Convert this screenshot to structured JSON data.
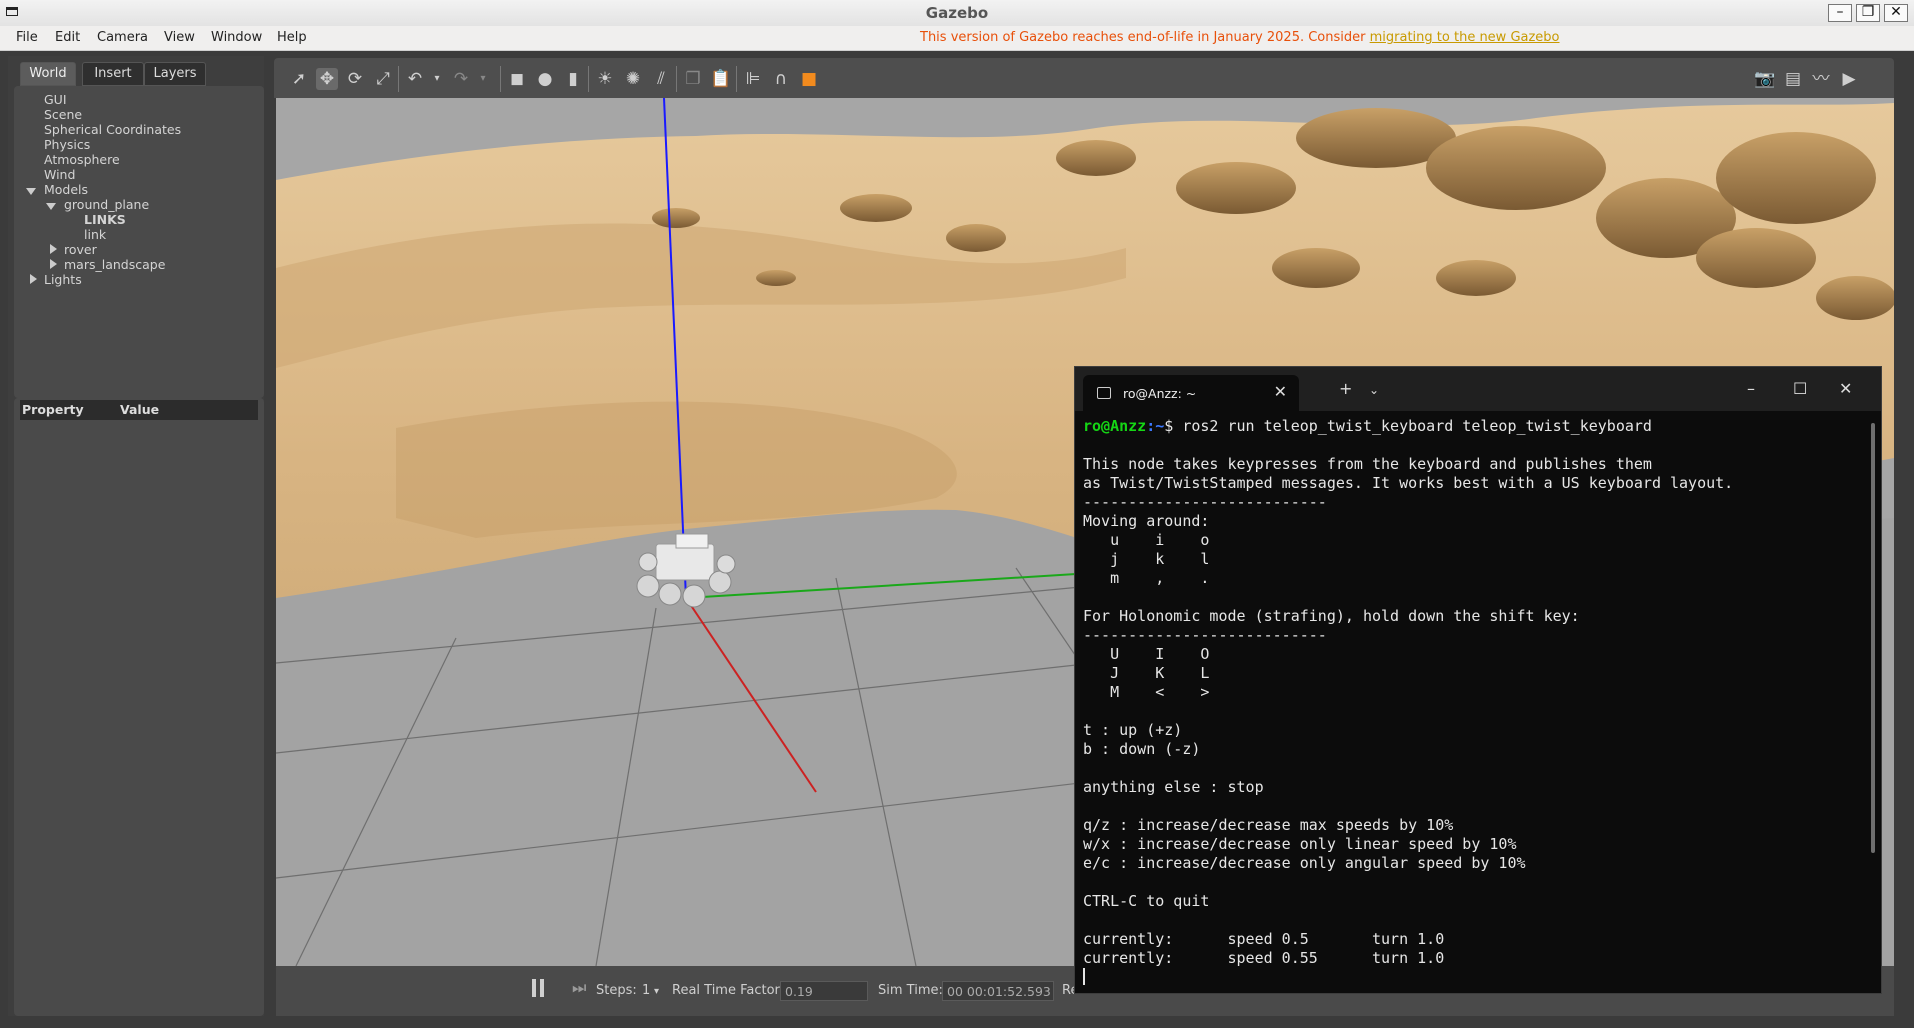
{
  "window": {
    "title": "Gazebo"
  },
  "menu": {
    "items": [
      "File",
      "Edit",
      "Camera",
      "View",
      "Window",
      "Help"
    ],
    "notice_prefix": "This version of Gazebo reaches end-of-life in January 2025. Consider ",
    "notice_link": "migrating to the new Gazebo"
  },
  "left_panel": {
    "tabs": [
      "World",
      "Insert",
      "Layers"
    ],
    "tree": {
      "gui": "GUI",
      "scene": "Scene",
      "spherical": "Spherical Coordinates",
      "physics": "Physics",
      "atmosphere": "Atmosphere",
      "wind": "Wind",
      "models": "Models",
      "ground_plane": "ground_plane",
      "links": "LINKS",
      "link": "link",
      "rover": "rover",
      "mars_landscape": "mars_landscape",
      "lights": "Lights"
    },
    "property_header": "Property",
    "value_header": "Value"
  },
  "toolbar": {
    "tools": [
      "select-icon",
      "translate-icon",
      "rotate-icon",
      "scale-icon",
      "undo-icon",
      "redo-icon",
      "box-icon",
      "sphere-icon",
      "cylinder-icon",
      "point-light-icon",
      "spot-light-icon",
      "directional-light-icon",
      "copy-icon",
      "paste-icon",
      "align-icon",
      "snap-icon",
      "change-view-icon",
      "screenshot-icon",
      "log-icon",
      "plot-icon",
      "video-icon"
    ]
  },
  "status_bar": {
    "steps_label": "Steps:",
    "steps_value": "1",
    "rtf_label": "Real Time Factor:",
    "rtf_value": "0.19",
    "sim_time_label": "Sim Time:",
    "sim_time_value": "00 00:01:52.593",
    "real_time_label": "Real Time:"
  },
  "terminal": {
    "tab_title": "ro@Anzz: ~",
    "prompt_user": "ro@Anzz",
    "prompt_path": ":~",
    "command": "$ ros2 run teleop_twist_keyboard teleop_twist_keyboard",
    "output": "\nThis node takes keypresses from the keyboard and publishes them\nas Twist/TwistStamped messages. It works best with a US keyboard layout.\n---------------------------\nMoving around:\n   u    i    o\n   j    k    l\n   m    ,    .\n\nFor Holonomic mode (strafing), hold down the shift key:\n---------------------------\n   U    I    O\n   J    K    L\n   M    <    >\n\nt : up (+z)\nb : down (-z)\n\nanything else : stop\n\nq/z : increase/decrease max speeds by 10%\nw/x : increase/decrease only linear speed by 10%\ne/c : increase/decrease only angular speed by 10%\n\nCTRL-C to quit\n\ncurrently:\tspeed 0.5\tturn 1.0 \ncurrently:\tspeed 0.55\tturn 1.0 \n"
  },
  "colors": {
    "notice": "#e8500a",
    "prompt_user": "#15d615",
    "prompt_path": "#3b78ff",
    "terminal_bg": "#0c0c0c",
    "sand": "#d9b98a"
  }
}
